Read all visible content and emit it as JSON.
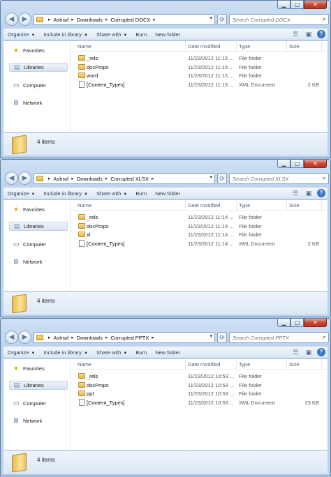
{
  "windows": [
    {
      "breadcrumb": [
        "Ashraf",
        "Downloads",
        "Corrupted DOCX"
      ],
      "search_placeholder": "Search Corrupted DOCX",
      "toolbar": {
        "organize": "Organize",
        "include": "Include in library",
        "share": "Share with",
        "burn": "Burn",
        "new_folder": "New folder"
      },
      "nav": {
        "favorites": "Favorites",
        "libraries": "Libraries",
        "computer": "Computer",
        "network": "Network"
      },
      "columns": {
        "name": "Name",
        "date": "Date modified",
        "type": "Type",
        "size": "Size"
      },
      "files": [
        {
          "name": "_rels",
          "date": "11/23/2012 11:15 ...",
          "type": "File folder",
          "size": "",
          "icon": "folder-icon"
        },
        {
          "name": "docProps",
          "date": "11/23/2012 11:15 ...",
          "type": "File folder",
          "size": "",
          "icon": "folder-icon"
        },
        {
          "name": "word",
          "date": "11/23/2012 11:15 ...",
          "type": "File folder",
          "size": "",
          "icon": "folder-icon"
        },
        {
          "name": "[Content_Types]",
          "date": "11/23/2012 11:15 ...",
          "type": "XML Document",
          "size": "2 KB",
          "icon": "xml-document-icon"
        }
      ],
      "status": "4 items"
    },
    {
      "breadcrumb": [
        "Ashraf",
        "Downloads",
        "Corrupted XLSX"
      ],
      "search_placeholder": "Search Corrupted XLSX",
      "toolbar": {
        "organize": "Organize",
        "include": "Include in library",
        "share": "Share with",
        "burn": "Burn",
        "new_folder": "New folder"
      },
      "nav": {
        "favorites": "Favorites",
        "libraries": "Libraries",
        "computer": "Computer",
        "network": "Network"
      },
      "columns": {
        "name": "Name",
        "date": "Date modified",
        "type": "Type",
        "size": "Size"
      },
      "files": [
        {
          "name": "_rels",
          "date": "11/23/2012 11:14 ...",
          "type": "File folder",
          "size": "",
          "icon": "folder-icon"
        },
        {
          "name": "docProps",
          "date": "11/23/2012 11:14 ...",
          "type": "File folder",
          "size": "",
          "icon": "folder-icon"
        },
        {
          "name": "xl",
          "date": "11/23/2012 11:14 ...",
          "type": "File folder",
          "size": "",
          "icon": "folder-icon"
        },
        {
          "name": "[Content_Types]",
          "date": "11/23/2012 11:14 ...",
          "type": "XML Document",
          "size": "2 KB",
          "icon": "xml-document-icon"
        }
      ],
      "status": "4 items"
    },
    {
      "breadcrumb": [
        "Ashraf",
        "Downloads",
        "Corrupted PPTX"
      ],
      "search_placeholder": "Search Corrupted PPTX",
      "toolbar": {
        "organize": "Organize",
        "include": "Include in library",
        "share": "Share with",
        "burn": "Burn",
        "new_folder": "New folder"
      },
      "nav": {
        "favorites": "Favorites",
        "libraries": "Libraries",
        "computer": "Computer",
        "network": "Network"
      },
      "columns": {
        "name": "Name",
        "date": "Date modified",
        "type": "Type",
        "size": "Size"
      },
      "files": [
        {
          "name": "_rels",
          "date": "11/23/2012 10:53 ...",
          "type": "File folder",
          "size": "",
          "icon": "folder-icon"
        },
        {
          "name": "docProps",
          "date": "11/23/2012 10:53 ...",
          "type": "File folder",
          "size": "",
          "icon": "folder-icon"
        },
        {
          "name": "ppt",
          "date": "11/23/2012 10:53 ...",
          "type": "File folder",
          "size": "",
          "icon": "folder-icon"
        },
        {
          "name": "[Content_Types]",
          "date": "11/23/2012 10:53 ...",
          "type": "XML Document",
          "size": "23 KB",
          "icon": "xml-document-icon"
        }
      ],
      "status": "4 items"
    }
  ],
  "colors": {
    "accent": "#3974c0",
    "close": "#c8442c",
    "frame": "#bcd3ee"
  }
}
